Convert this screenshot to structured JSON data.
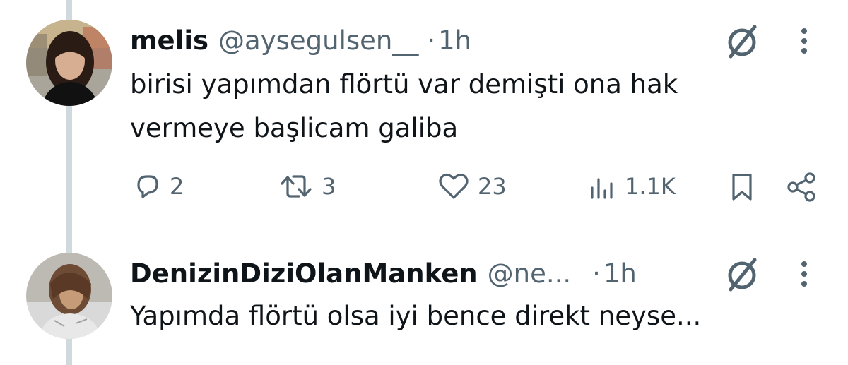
{
  "tweets": [
    {
      "display_name": "melis",
      "handle": "@aysegulsen__",
      "separator": "·",
      "time": "1h",
      "text_line1": "birisi yapımdan flörtü var demişti ona hak",
      "text_line2": "vermeye başlicam galiba",
      "reply_count": "2",
      "retweet_count": "3",
      "like_count": "23",
      "view_count": "1.1K"
    },
    {
      "display_name": "DenizinDiziOlanManken",
      "handle": "@ne...",
      "separator": "·",
      "time": "1h",
      "text_line1": "Yapımda flörtü olsa iyi bence direkt neyse..."
    }
  ],
  "icons": {
    "reply": "reply-icon",
    "retweet": "retweet-icon",
    "like": "heart-icon",
    "views": "views-icon",
    "bookmark": "bookmark-icon",
    "share": "share-icon",
    "grok": "grok-icon",
    "more": "more-vertical-icon"
  },
  "colors": {
    "text": "#0f1419",
    "secondary": "#536471",
    "thread_line": "#cfd9de"
  }
}
